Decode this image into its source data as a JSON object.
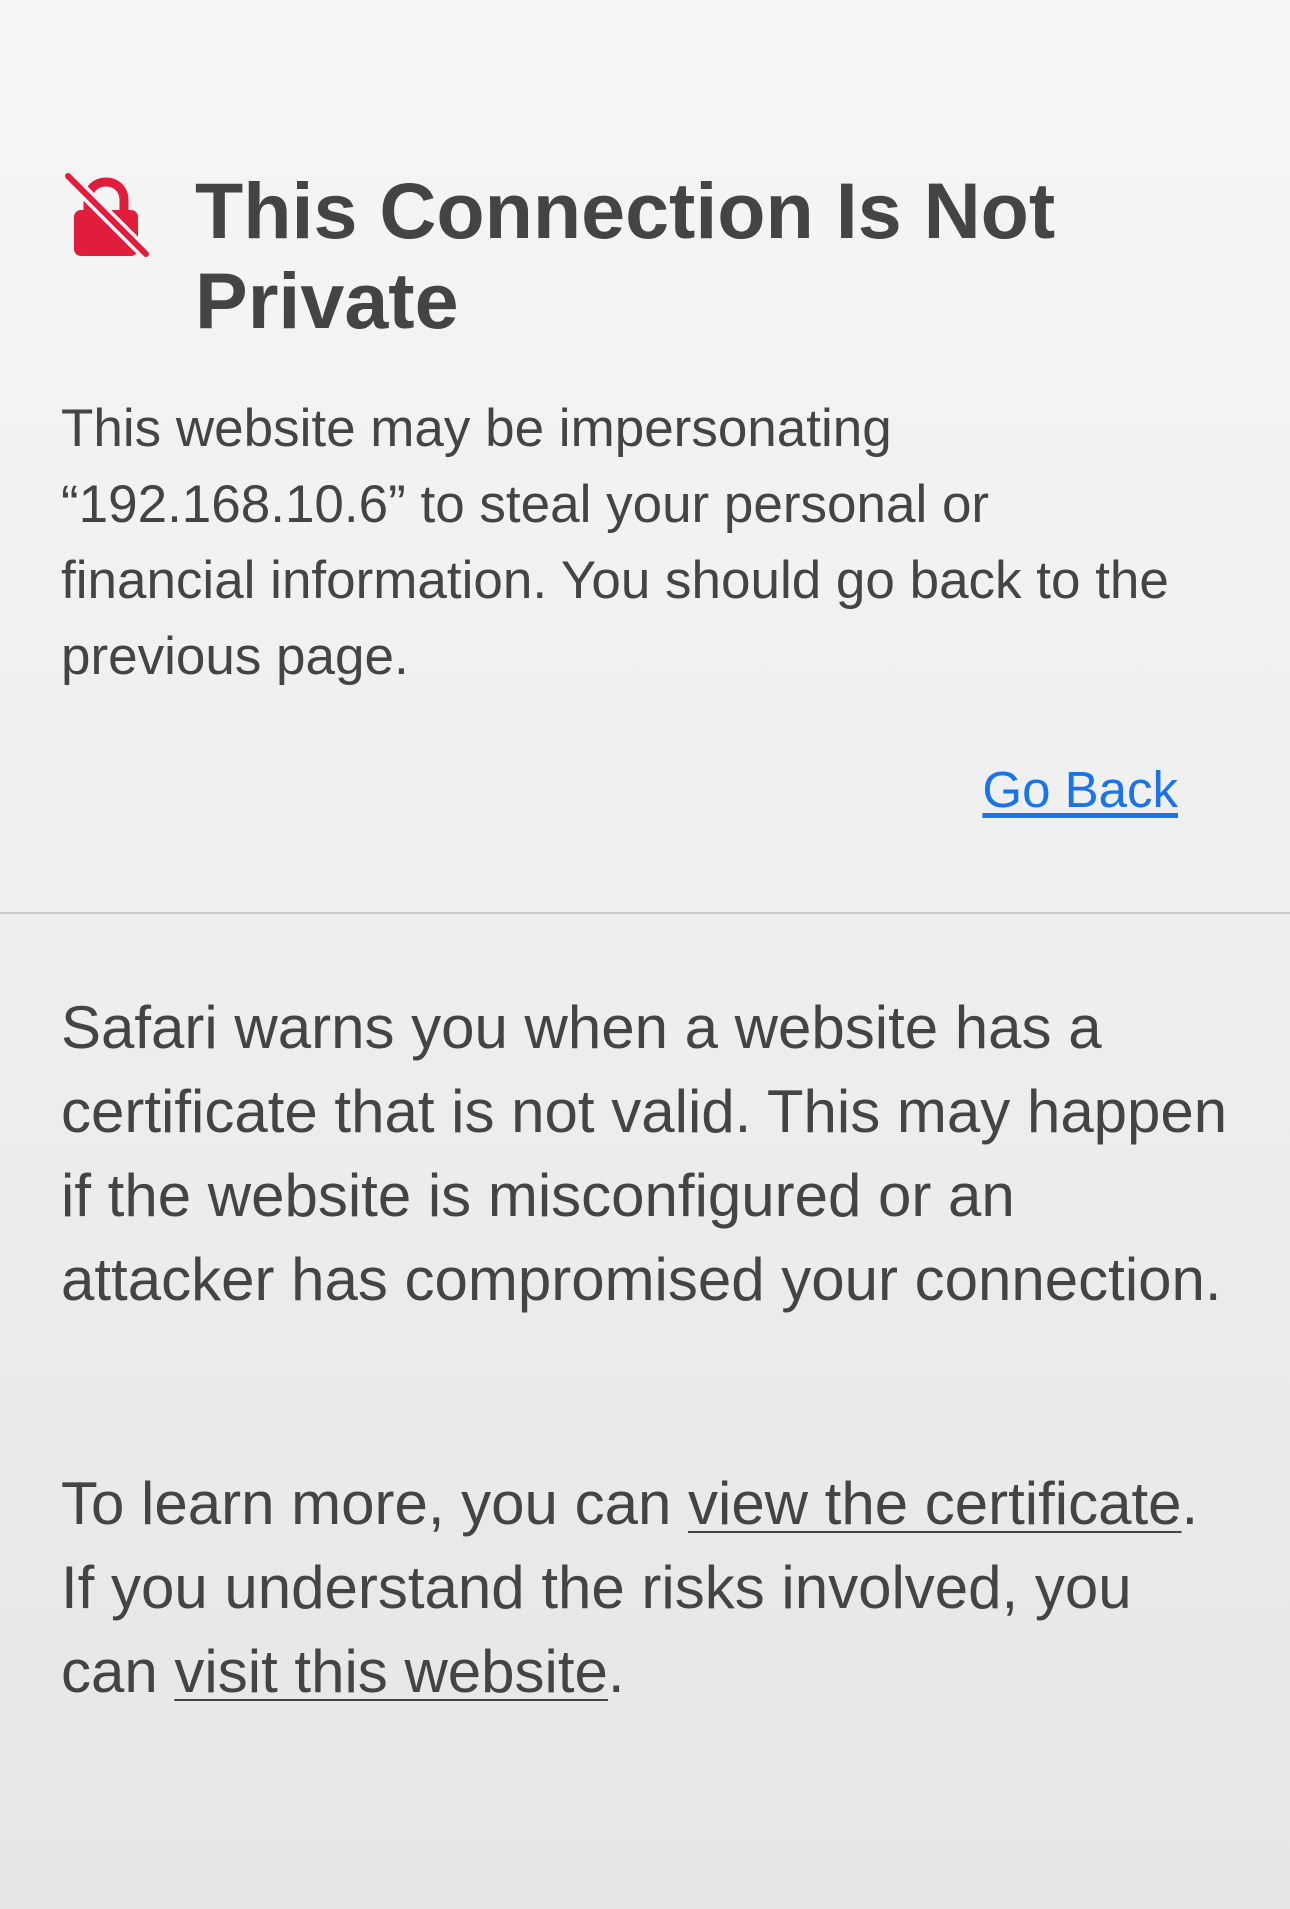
{
  "header": {
    "icon": "lock-slash-icon",
    "icon_color": "#e01e3c",
    "title": "This Connection Is Not Private"
  },
  "intro": {
    "text": "This website may be impersonating “192.168.10.6” to steal your personal or financial information. You should go back to the previous page."
  },
  "actions": {
    "go_back_label": "Go Back",
    "link_color": "#1a73e8"
  },
  "details": {
    "explanation": "Safari warns you when a website has a certificate that is not valid. This may happen if the website is misconfigured or an attacker has compromised your connection.",
    "learn_more_prefix": "To learn more, you can ",
    "view_certificate_label": "view the certificate",
    "learn_more_middle": ". If you understand the risks involved, you can ",
    "visit_website_label": "visit this website",
    "learn_more_suffix": "."
  }
}
